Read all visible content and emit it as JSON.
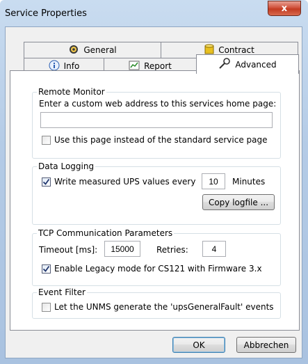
{
  "window": {
    "title": "Service Properties",
    "close_glyph": "x"
  },
  "tabs": {
    "row1": [
      {
        "label": "General",
        "icon": "gear-icon"
      },
      {
        "label": "Contract",
        "icon": "database-icon"
      }
    ],
    "row2": [
      {
        "label": "Info",
        "icon": "info-icon"
      },
      {
        "label": "Report",
        "icon": "report-icon"
      },
      {
        "label": "Advanced",
        "icon": "wrench-icon",
        "selected": true
      }
    ]
  },
  "remote_monitor": {
    "title": "Remote Monitor",
    "prompt": "Enter a custom web address to this services home page:",
    "url_value": "",
    "use_page_label": "Use this page instead of the standard service page",
    "use_page_checked": false
  },
  "data_logging": {
    "title": "Data Logging",
    "write_label": "Write measured UPS values every",
    "write_checked": true,
    "interval_value": "10",
    "interval_unit": "Minutes",
    "copy_button": "Copy logfile ..."
  },
  "tcp": {
    "title": "TCP Communication Parameters",
    "timeout_label": "Timeout [ms]:",
    "timeout_value": "15000",
    "retries_label": "Retries:",
    "retries_value": "4",
    "legacy_label": "Enable Legacy mode for CS121 with Firmware 3.x",
    "legacy_checked": true
  },
  "event_filter": {
    "title": "Event Filter",
    "fault_label": "Let the UNMS generate the 'upsGeneralFault' events",
    "fault_checked": false
  },
  "footer": {
    "ok_label": "OK",
    "cancel_label": "Abbrechen"
  }
}
